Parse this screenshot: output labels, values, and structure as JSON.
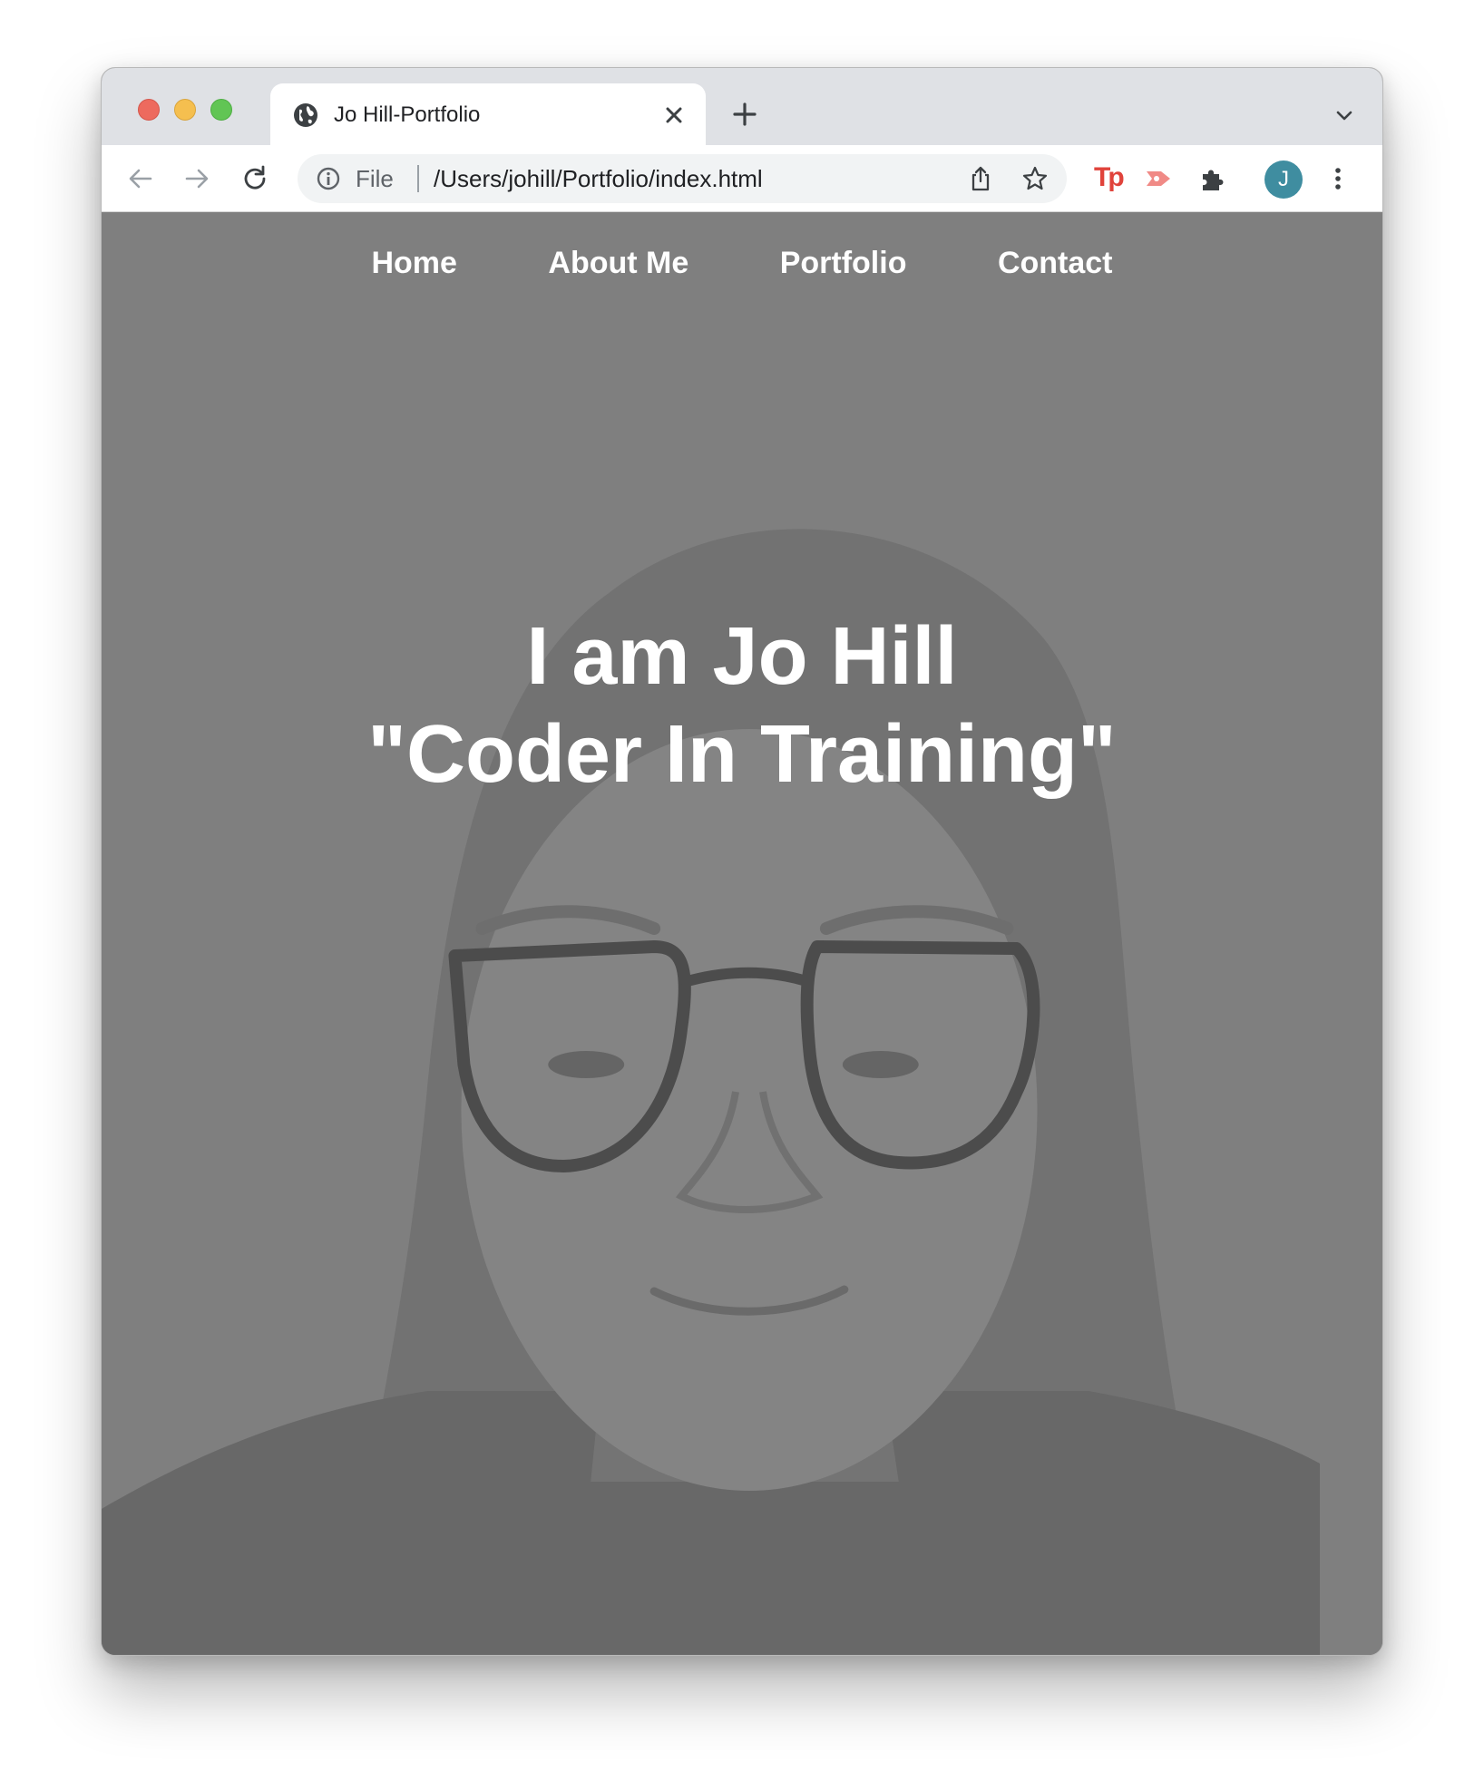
{
  "browser": {
    "tab_title": "Jo Hill-Portfolio",
    "address_scheme": "File",
    "url": "/Users/johill/Portfolio/index.html",
    "extension_tp": "Tp",
    "profile_initial": "J"
  },
  "nav": {
    "items": [
      {
        "label": "Home"
      },
      {
        "label": "About Me"
      },
      {
        "label": "Portfolio"
      },
      {
        "label": "Contact"
      }
    ]
  },
  "hero": {
    "line1": "I am Jo Hill",
    "line2": "\"Coder In Training\""
  },
  "colors": {
    "overlay": "#7f7f7f",
    "text": "#ffffff",
    "avatar": "#3f8da0",
    "extension_red": "#e0433b"
  }
}
